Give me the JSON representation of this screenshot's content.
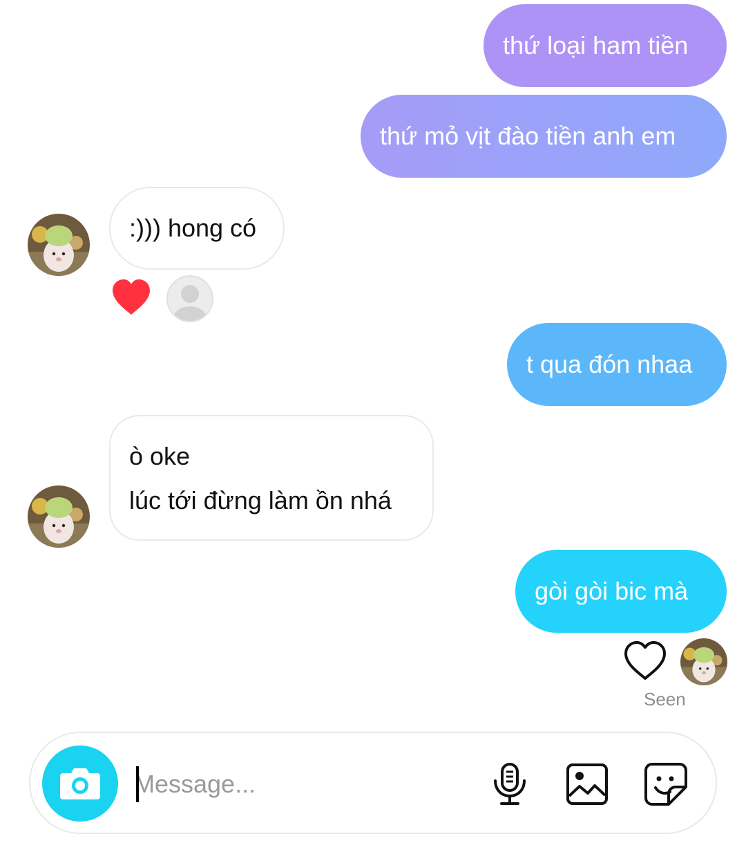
{
  "messages": {
    "out1": "thứ loại ham tiền",
    "out2": "thứ mỏ vịt đào tiền anh em",
    "in1": ":))) hong có",
    "out3": "t qua đón nhaa",
    "in2_line1": "ò oke",
    "in2_line2": "lúc tới đừng làm ồn nhá",
    "out4": "gòi gòi bic mà"
  },
  "status": {
    "seen": "Seen"
  },
  "composer": {
    "placeholder": "Message..."
  },
  "colors": {
    "out1": "#ae93f6",
    "out2_from": "#a59cf8",
    "out2_to": "#8fa9fa",
    "out3": "#5bb7fa",
    "out4": "#24d2fb",
    "heart": "#ff3040",
    "camera": "#1ad3f1"
  },
  "icons": [
    "heart-icon",
    "reactor-avatar-placeholder-icon",
    "heart-outline-icon",
    "camera-icon",
    "microphone-icon",
    "image-icon",
    "sticker-icon"
  ]
}
